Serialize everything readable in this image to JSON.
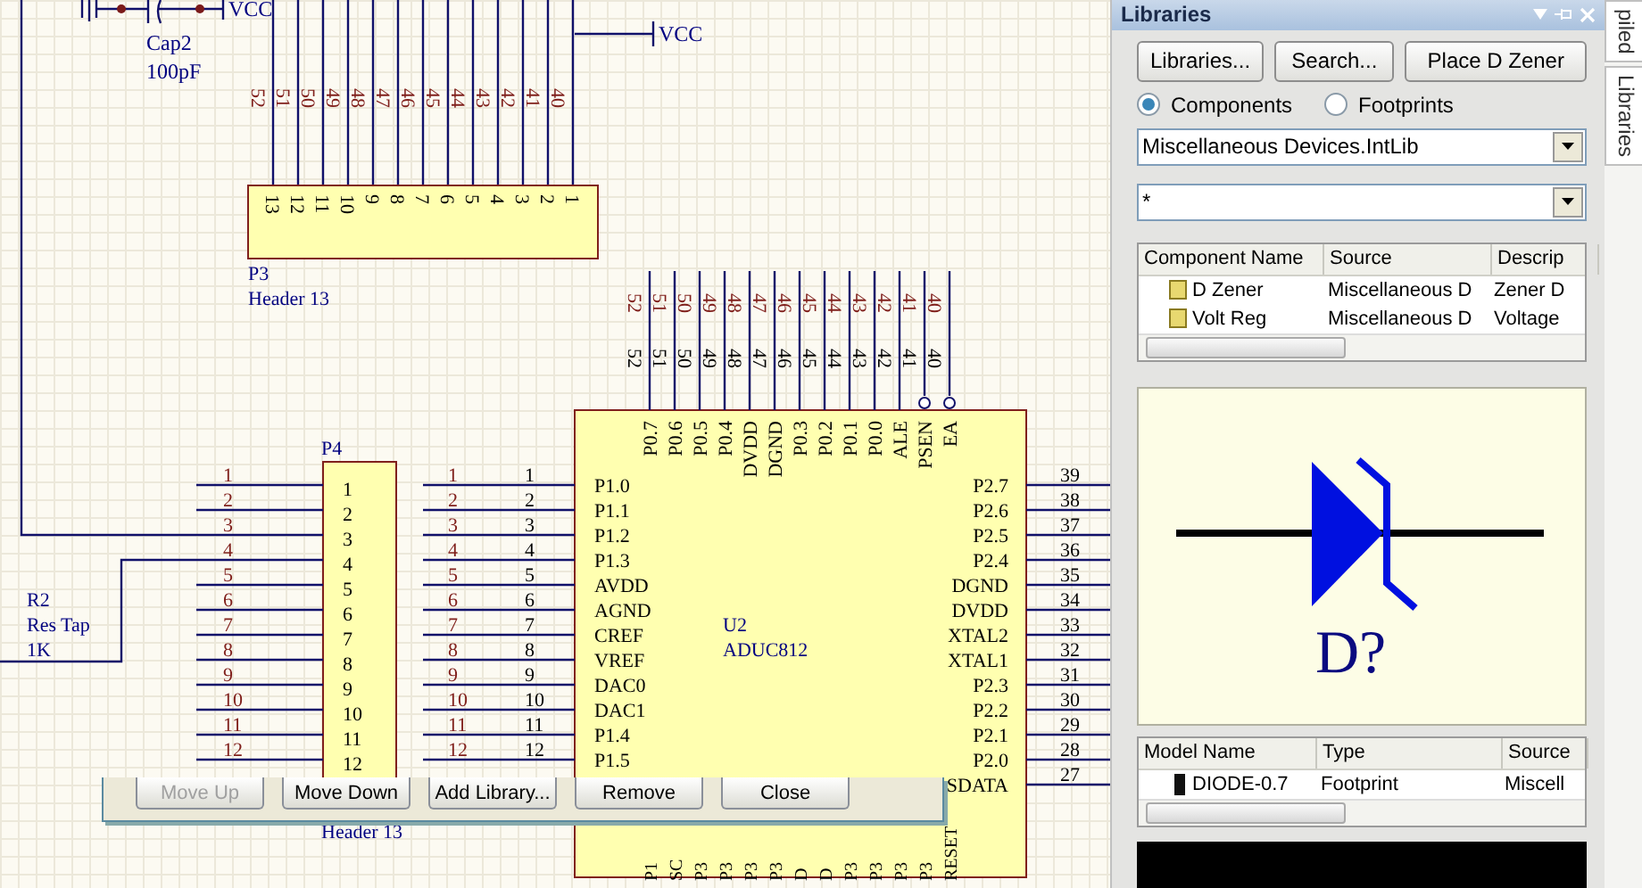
{
  "schematic": {
    "capacitor": {
      "ref": "Cap2",
      "value": "100pF",
      "power_label": "VCC"
    },
    "power_label": "VCC",
    "p3": {
      "ref": "P3",
      "comment": "Header 13",
      "pins": [
        "13",
        "12",
        "11",
        "10",
        "9",
        "8",
        "7",
        "6",
        "5",
        "4",
        "3",
        "2",
        "1"
      ],
      "net_labels": [
        "52",
        "51",
        "50",
        "49",
        "48",
        "47",
        "46",
        "45",
        "44",
        "43",
        "42",
        "41",
        "40"
      ]
    },
    "p4": {
      "ref": "P4",
      "comment": "Header 13",
      "pins": [
        "1",
        "2",
        "3",
        "4",
        "5",
        "6",
        "7",
        "8",
        "9",
        "10",
        "11",
        "12"
      ],
      "net_labels": [
        "1",
        "2",
        "3",
        "4",
        "5",
        "6",
        "7",
        "8",
        "9",
        "10",
        "11",
        "12"
      ]
    },
    "r2": {
      "ref": "R2",
      "comment": "Res Tap",
      "value": "1K"
    },
    "u2": {
      "ref": "U2",
      "comment": "ADUC812",
      "top_net_labels": [
        "52",
        "51",
        "50",
        "49",
        "48",
        "47",
        "46",
        "45",
        "44",
        "43",
        "42",
        "41",
        "40"
      ],
      "top_pin_numbers": [
        "52",
        "51",
        "50",
        "49",
        "48",
        "47",
        "46",
        "45",
        "44",
        "43",
        "42",
        "41",
        "40"
      ],
      "top_pins": [
        "P0.7",
        "P0.6",
        "P0.5",
        "P0.4",
        "DVDD",
        "DGND",
        "P0.3",
        "P0.2",
        "P0.1",
        "P0.0",
        "ALE",
        "PSEN",
        "EA"
      ],
      "left_net_labels": [
        "1",
        "2",
        "3",
        "4",
        "5",
        "6",
        "7",
        "8",
        "9",
        "10",
        "11",
        "12"
      ],
      "left_pin_numbers": [
        "1",
        "2",
        "3",
        "4",
        "5",
        "6",
        "7",
        "8",
        "9",
        "10",
        "11",
        "12"
      ],
      "left_pins": [
        "P1.0",
        "P1.1",
        "P1.2",
        "P1.3",
        "AVDD",
        "AGND",
        "CREF",
        "VREF",
        "DAC0",
        "DAC1",
        "P1.4",
        "P1.5"
      ],
      "right_pins": [
        "P2.7",
        "P2.6",
        "P2.5",
        "P2.4",
        "DGND",
        "DVDD",
        "XTAL2",
        "XTAL1",
        "P2.3",
        "P2.2",
        "P2.1",
        "P2.0",
        "SDATA"
      ],
      "right_pin_numbers": [
        "39",
        "38",
        "37",
        "36",
        "35",
        "34",
        "33",
        "32",
        "31",
        "30",
        "29",
        "28",
        "27"
      ],
      "bottom_pins": [
        "P1",
        "SC",
        "P3",
        "P3",
        "P3",
        "P3",
        "D",
        "D",
        "P3",
        "P3",
        "P3",
        "P3",
        "RESET"
      ]
    }
  },
  "dialog": {
    "buttons": [
      {
        "label": "Move Up",
        "disabled": true
      },
      {
        "label": "Move Down",
        "disabled": false
      },
      {
        "label": "Add Library...",
        "disabled": false
      },
      {
        "label": "Remove",
        "disabled": false
      },
      {
        "label": "Close",
        "disabled": false
      }
    ]
  },
  "libraries_panel": {
    "title": "Libraries",
    "buttons": [
      "Libraries...",
      "Search...",
      "Place D Zener"
    ],
    "radios": [
      {
        "label": "Components",
        "selected": true
      },
      {
        "label": "Footprints",
        "selected": false
      }
    ],
    "library": "Miscellaneous Devices.IntLib",
    "filter": "*",
    "component_table": {
      "columns": [
        "Component Name",
        "Source",
        "Descrip"
      ],
      "rows": [
        {
          "cells": [
            "D Zener",
            "Miscellaneous D",
            "Zener D"
          ]
        },
        {
          "cells": [
            "Volt Reg",
            "Miscellaneous D",
            "Voltage"
          ]
        }
      ]
    },
    "preview": {
      "designator": "D?"
    },
    "model_table": {
      "columns": [
        "Model Name",
        "Type",
        "Source"
      ],
      "rows": [
        {
          "cells": [
            "DIODE-0.7",
            "Footprint",
            "Miscell"
          ]
        }
      ]
    }
  },
  "side_tabs": [
    "piled",
    "Libraries"
  ]
}
